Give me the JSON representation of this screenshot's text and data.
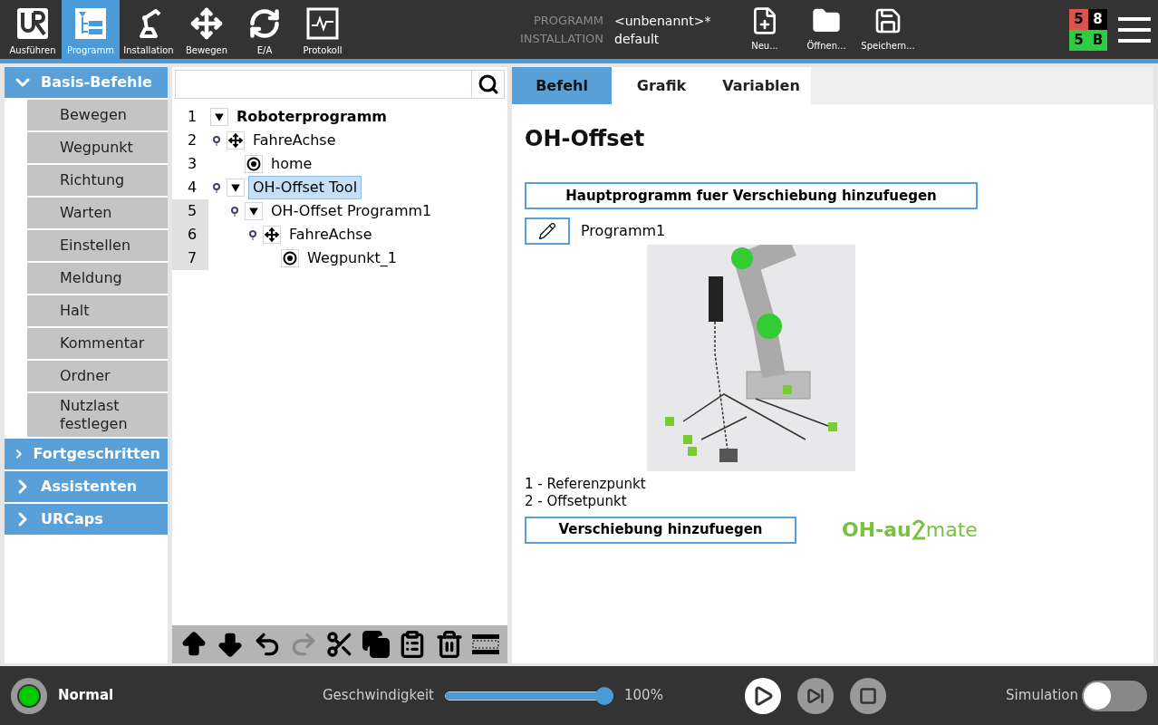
{
  "nav": [
    {
      "label": "Ausführen",
      "selected": false
    },
    {
      "label": "Programm",
      "selected": true
    },
    {
      "label": "Installation",
      "selected": false
    },
    {
      "label": "Bewegen",
      "selected": false
    },
    {
      "label": "E/A",
      "selected": false
    },
    {
      "label": "Protokoll",
      "selected": false
    }
  ],
  "file_info": [
    {
      "label": "PROGRAMM",
      "value": "<unbenannt>*"
    },
    {
      "label": "INSTALLATION",
      "value": "default"
    }
  ],
  "file_buttons": [
    "Neu...",
    "Öffnen...",
    "Speichern..."
  ],
  "status_grid": [
    {
      "text": "5",
      "color": "#d9534f"
    },
    {
      "text": "8",
      "color": "#000000"
    },
    {
      "text": "5",
      "color": "#2ecc40"
    },
    {
      "text": "B",
      "color": "#2ecc40"
    }
  ],
  "sidebar": [
    {
      "label": "Basis-Befehle",
      "expanded": true,
      "items": [
        "Bewegen",
        "Wegpunkt",
        "Richtung",
        "Warten",
        "Einstellen",
        "Meldung",
        "Halt",
        "Kommentar",
        "Ordner",
        "Nutzlast festlegen"
      ]
    },
    {
      "label": "Fortgeschritten",
      "expanded": false
    },
    {
      "label": "Assistenten",
      "expanded": false
    },
    {
      "label": "URCaps",
      "expanded": false
    }
  ],
  "tree": {
    "nodes": [
      {
        "number": "1",
        "label": "Roboterprogramm",
        "kind": "root",
        "selected": false,
        "shaded": false,
        "children": [
          {
            "number": "2",
            "label": "FahreAchse",
            "kind": "move",
            "selected": false,
            "shaded": false,
            "children": [
              {
                "number": "3",
                "label": "home",
                "kind": "waypoint",
                "selected": false,
                "shaded": false
              }
            ]
          },
          {
            "number": "4",
            "label": "OH-Offset Tool",
            "kind": "folder",
            "selected": true,
            "shaded": false,
            "children": [
              {
                "number": "5",
                "label": "OH-Offset Programm1",
                "kind": "folder",
                "selected": false,
                "shaded": true,
                "children": [
                  {
                    "number": "6",
                    "label": "FahreAchse",
                    "kind": "move",
                    "selected": false,
                    "shaded": true,
                    "children": [
                      {
                        "number": "7",
                        "label": "Wegpunkt_1",
                        "kind": "waypoint",
                        "selected": false,
                        "shaded": true
                      }
                    ]
                  }
                ]
              }
            ]
          }
        ]
      }
    ],
    "toolbar": [
      {
        "disabled": false
      },
      {
        "disabled": false
      },
      {
        "disabled": false
      },
      {
        "disabled": true
      },
      {
        "disabled": false
      },
      {
        "disabled": false
      },
      {
        "disabled": false
      },
      {
        "disabled": false
      },
      {
        "disabled": false
      }
    ]
  },
  "tabs": [
    {
      "label": "Befehl",
      "selected": true
    },
    {
      "label": "Grafik",
      "selected": false
    },
    {
      "label": "Variablen",
      "selected": false
    }
  ],
  "command": {
    "title": "OH-Offset",
    "main_button": "Hauptprogramm fuer Verschiebung hinzufuegen",
    "program_name": "Programm1",
    "legend": [
      "1 - Referenzpunkt",
      "2 - Offsetpunkt"
    ],
    "offset_button": "Verschiebung hinzufuegen",
    "logo": {
      "left": "OH-au",
      "right": "mate"
    }
  },
  "footer": {
    "mode": "Normal",
    "speed_label": "Geschwindigkeit",
    "speed": {
      "level": 1.0
    },
    "speed_reading": "100%",
    "simulation": {
      "label": "Simulation",
      "on": false
    }
  }
}
